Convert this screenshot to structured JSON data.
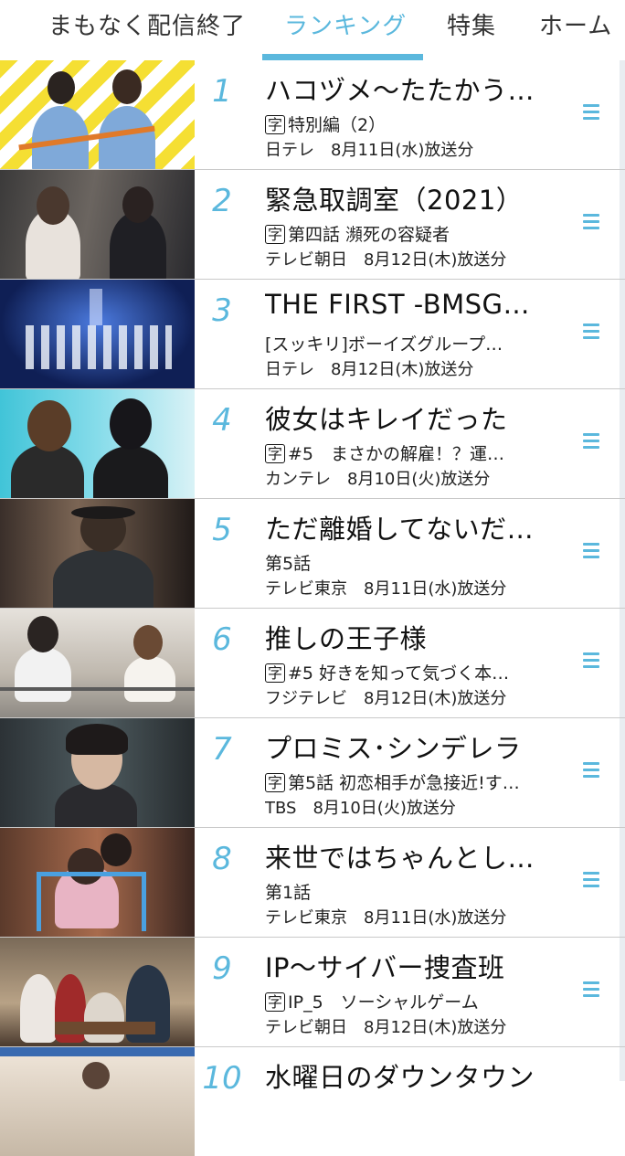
{
  "tabs": [
    {
      "label": "まもなく配信終了",
      "active": false
    },
    {
      "label": "ランキング",
      "active": true
    },
    {
      "label": "特集",
      "active": false
    },
    {
      "label": "ホーム",
      "active": false
    }
  ],
  "subtitle_badge": "字",
  "items": [
    {
      "rank": "1",
      "title": "ハコヅメ〜たたかう…",
      "caption": "字",
      "subtitle": "特別編（2）",
      "meta": "日テレ　8月11日(水)放送分"
    },
    {
      "rank": "2",
      "title": "緊急取調室（2021）",
      "caption": "字",
      "subtitle": "第四話 瀕死の容疑者",
      "meta": "テレビ朝日　8月12日(木)放送分"
    },
    {
      "rank": "3",
      "title": "THE FIRST -BMSG…",
      "caption": "",
      "subtitle": "[スッキリ]ボーイズグループ…",
      "meta": "日テレ　8月12日(木)放送分"
    },
    {
      "rank": "4",
      "title": "彼女はキレイだった",
      "caption": "字",
      "subtitle": "#5　まさかの解雇！？運…",
      "meta": "カンテレ　8月10日(火)放送分"
    },
    {
      "rank": "5",
      "title": "ただ離婚してないだ…",
      "caption": "",
      "subtitle": "第5話",
      "meta": "テレビ東京　8月11日(水)放送分"
    },
    {
      "rank": "6",
      "title": "推しの王子様",
      "caption": "字",
      "subtitle": "#5 好きを知って気づく本…",
      "meta": "フジテレビ　8月12日(木)放送分"
    },
    {
      "rank": "7",
      "title": "プロミス･シンデレラ",
      "caption": "字",
      "subtitle": "第5話 初恋相手が急接近!す…",
      "meta": "TBS　8月10日(火)放送分"
    },
    {
      "rank": "8",
      "title": "来世ではちゃんとし…",
      "caption": "",
      "subtitle": "第1話",
      "meta": "テレビ東京　8月11日(水)放送分"
    },
    {
      "rank": "9",
      "title": "IP〜サイバー捜査班",
      "caption": "字",
      "subtitle": "IP_5　ソーシャルゲーム",
      "meta": "テレビ朝日　8月12日(木)放送分"
    },
    {
      "rank": "10",
      "title": "水曜日のダウンタウン",
      "caption": "",
      "subtitle": "",
      "meta": ""
    }
  ],
  "colors": {
    "accent": "#5bb8dd",
    "divider": "#c9c9c9"
  },
  "icons": {
    "row_menu": "hamburger-menu-icon"
  }
}
